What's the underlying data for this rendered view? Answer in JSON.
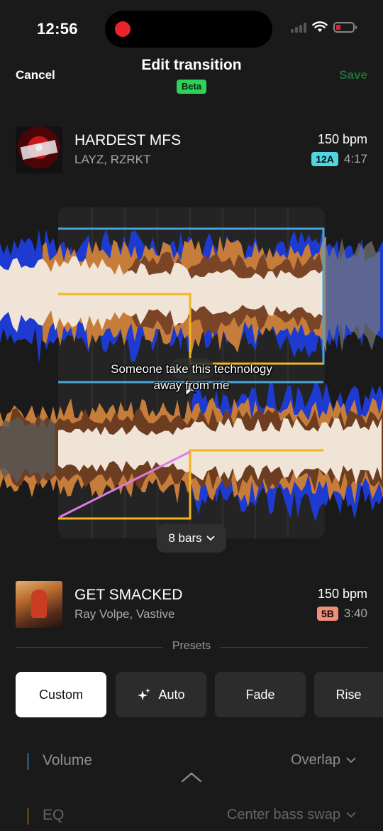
{
  "status_bar": {
    "time": "12:56"
  },
  "header": {
    "cancel_label": "Cancel",
    "title": "Edit transition",
    "badge": "Beta",
    "save_label": "Save"
  },
  "track_top": {
    "title": "HARDEST MFS",
    "artist": "LAYZ, RZRKT",
    "bpm": "150 bpm",
    "key": "12A",
    "key_color": "#4fd6e0",
    "duration": "4:17"
  },
  "waveform": {
    "caption": "Someone take this technology away from me",
    "bars_label": "8 bars"
  },
  "track_bottom": {
    "title": "GET SMACKED",
    "artist": "Ray Volpe, Vastive",
    "bpm": "150 bpm",
    "key": "5B",
    "key_color": "#f08e7a",
    "duration": "3:40"
  },
  "presets": {
    "label": "Presets",
    "items": [
      {
        "label": "Custom",
        "active": true
      },
      {
        "label": "Auto",
        "icon": "sparkle-icon"
      },
      {
        "label": "Fade"
      },
      {
        "label": "Rise"
      }
    ]
  },
  "settings": [
    {
      "label": "Volume",
      "value": "Overlap",
      "accent": "#2c86c9"
    },
    {
      "label": "EQ",
      "value": "Center bass swap",
      "accent": "#d48a1e"
    }
  ],
  "colors": {
    "save_disabled": "#1f6e33",
    "beta": "#2ed15a",
    "lane_blue": "#4aa3d8",
    "lane_yellow": "#f2b51c",
    "fade_line": "#e07ae8"
  }
}
